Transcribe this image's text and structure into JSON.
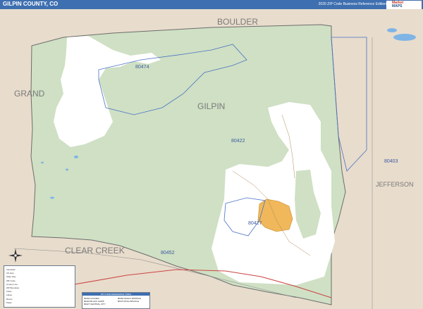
{
  "header": {
    "title": "GILPIN COUNTY, CO",
    "subtitle": "2020 ZIP Code Business Reference Edition"
  },
  "logo": {
    "line1": "Market",
    "line2": "MAPS"
  },
  "map": {
    "county_label": "GILPIN",
    "neighbor_labels": {
      "boulder": "BOULDER",
      "grand": "GRAND",
      "clear_creek": "CLEAR CREEK",
      "jefferson": "JEFFERSON"
    },
    "zip_labels": {
      "z80474": "80474",
      "z80422": "80422",
      "z80403": "80403",
      "z80427": "80427",
      "z80452": "80452"
    },
    "colors": {
      "county_fill": "#cfe0c4",
      "outside_fill": "#e8dccc",
      "city_fill": "#f0b85a",
      "water": "#7fb4e6",
      "header": "#3e6fb0"
    }
  },
  "legend": {
    "rows": [
      "Interstate",
      "US Hwy",
      "State Hwy",
      "ZIP Code",
      "County Line",
      "ZIP Boundary",
      "Cities",
      "Lakes",
      "Rivers",
      "Parks"
    ]
  },
  "zip_table": {
    "title": "ZIP CODE REFERENCE TABLE",
    "cols": [
      [
        "80403 GOLDEN",
        "80422 BLACK HAWK",
        "80427 CENTRAL CITY"
      ],
      [
        "80452 IDAHO SPRINGS",
        "80474 ROLLINSVILLE",
        ""
      ]
    ]
  }
}
